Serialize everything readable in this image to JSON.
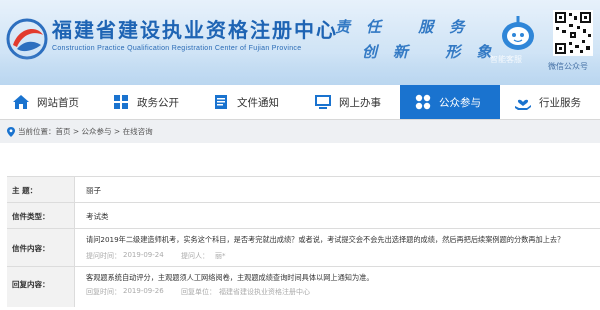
{
  "header": {
    "title": "福建省建设执业资格注册中心",
    "subtitle": "Construction Practice Qualification Registration Center of Fujian Province",
    "slogan_line1": "责任 服务",
    "slogan_line2": "创新 形象",
    "service_label": "智能客服",
    "wechat_label": "微信公众号"
  },
  "nav": {
    "items": [
      {
        "label": "网站首页",
        "icon": "home-icon"
      },
      {
        "label": "政务公开",
        "icon": "grid-icon"
      },
      {
        "label": "文件通知",
        "icon": "document-icon"
      },
      {
        "label": "网上办事",
        "icon": "monitor-icon"
      },
      {
        "label": "公众参与",
        "icon": "apps-icon",
        "active": true
      },
      {
        "label": "行业服务",
        "icon": "hand-heart-icon"
      }
    ],
    "active_color": "#1a73cf"
  },
  "breadcrumb": {
    "prefix": "当前位置：",
    "path": "首页 > 公众参与 > 在线咨询"
  },
  "detail": {
    "subject_label": "主    题：",
    "subject": "丽子",
    "type_label": "信件类型：",
    "type": "考试类",
    "content_label": "信件内容：",
    "content": "请问2019年二级建造师机考，实务这个科目，是否考完就出成绩？或者说，考试提交会不会先出选择题的成绩，然后再把后续案例题的分数再加上去？",
    "submit_time_label": "提问时间：",
    "submit_time": "2019-09-24",
    "asker_label": "提问人：",
    "asker": "丽*",
    "reply_label": "回复内容：",
    "reply": "客观题系统自动评分，主观题须人工网络阅卷，主观题成绩查询时间具体以网上通知为准。",
    "reply_time_label": "回复时间：",
    "reply_time": "2019-09-26",
    "reply_org_label": "回复单位：",
    "reply_org": "福建省建设执业资格注册中心"
  }
}
